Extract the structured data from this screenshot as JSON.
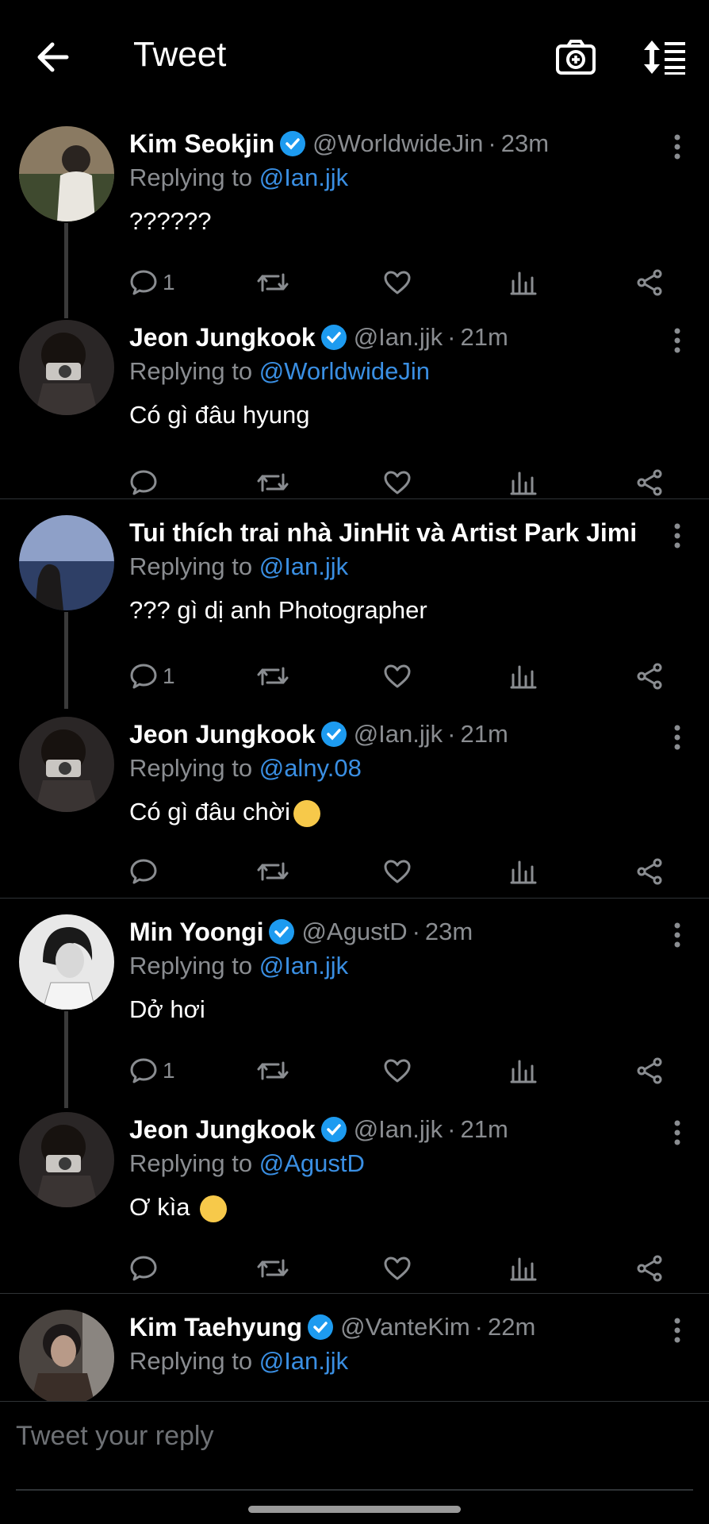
{
  "header": {
    "title": "Tweet",
    "back_icon": "arrow-left-icon",
    "camera_icon": "camera-plus-icon",
    "sort_icon": "sort-icon"
  },
  "tweets": [
    {
      "name": "Kim Seokjin",
      "handle": "@WorldwideJin",
      "time": "23m",
      "replying_prefix": "Replying to",
      "mention": "@Ian.jjk",
      "text": "??????",
      "reply_count": "1"
    },
    {
      "name": "Jeon Jungkook",
      "handle": "@Ian.jjk",
      "time": "21m",
      "replying_prefix": "Replying to",
      "mention": "@WorldwideJin",
      "text": "Có gì đâu hyung",
      "reply_count": ""
    },
    {
      "name": "Tui thích trai nhà JinHit và Artist Park Jimin ...",
      "handle": "",
      "time": "",
      "replying_prefix": "Replying to",
      "mention": "@Ian.jjk",
      "text": "??? gì dị anh Photographer",
      "reply_count": "1"
    },
    {
      "name": "Jeon Jungkook",
      "handle": "@Ian.jjk",
      "time": "21m",
      "replying_prefix": "Replying to",
      "mention": "@alny.08",
      "text": "Có gì đâu chời",
      "reply_count": ""
    },
    {
      "name": "Min Yoongi",
      "handle": "@AgustD",
      "time": "23m",
      "replying_prefix": "Replying to",
      "mention": "@Ian.jjk",
      "text": "Dở hơi",
      "reply_count": "1"
    },
    {
      "name": "Jeon Jungkook",
      "handle": "@Ian.jjk",
      "time": "21m",
      "replying_prefix": "Replying to",
      "mention": "@AgustD",
      "text": "Ơ kìa",
      "reply_count": ""
    },
    {
      "name": "Kim Taehyung",
      "handle": "@VanteKim",
      "time": "22m",
      "replying_prefix": "Replying to",
      "mention": "@Ian.jjk",
      "text": "",
      "reply_count": ""
    }
  ],
  "reply_box": {
    "placeholder": "Tweet your reply"
  },
  "colors": {
    "background": "#000000",
    "accent": "#3a8fe3",
    "muted": "#8a8d91",
    "verified": "#1d9bf0"
  }
}
